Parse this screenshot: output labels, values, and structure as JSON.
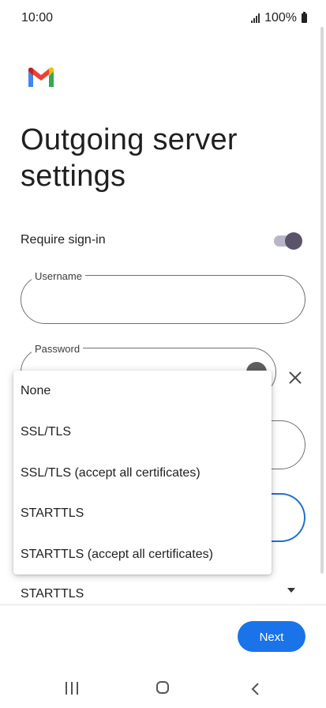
{
  "status_bar": {
    "time": "10:00",
    "battery": "100%"
  },
  "page": {
    "title": "Outgoing server settings"
  },
  "require_signin": {
    "label": "Require sign-in",
    "enabled": true
  },
  "fields": {
    "username_label": "Username",
    "username_value": "",
    "password_label": "Password"
  },
  "dropdown": {
    "options": [
      "None",
      "SSL/TLS",
      "SSL/TLS (accept all certificates)",
      "STARTTLS",
      "STARTTLS (accept all certificates)"
    ]
  },
  "security": {
    "selected": "STARTTLS"
  },
  "actions": {
    "next_label": "Next"
  },
  "colors": {
    "accent": "#1a73e8",
    "toggle_thumb": "#5b5369",
    "toggle_track": "#b9b4c8"
  },
  "icons": {
    "logo": "gmail-logo-icon",
    "password_toggle": "eye-icon",
    "clear": "close-icon",
    "dropdown": "caret-down-icon",
    "nav_recents": "recents-icon",
    "nav_home": "home-icon",
    "nav_back": "back-icon"
  }
}
